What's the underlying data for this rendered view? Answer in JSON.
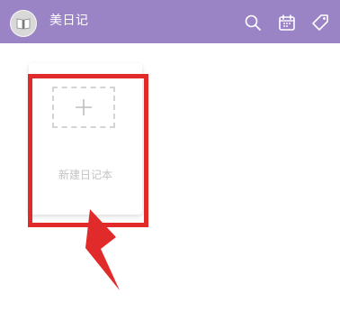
{
  "header": {
    "title": "美日记",
    "bg_color": "#9b84c6",
    "icons": [
      "book-icon",
      "search-icon",
      "calendar-icon",
      "tag-icon"
    ]
  },
  "notebook_list": {
    "new_card": {
      "label": "新建日记本",
      "icon": "plus-icon"
    }
  },
  "annotation": {
    "color": "#e12b2b"
  }
}
